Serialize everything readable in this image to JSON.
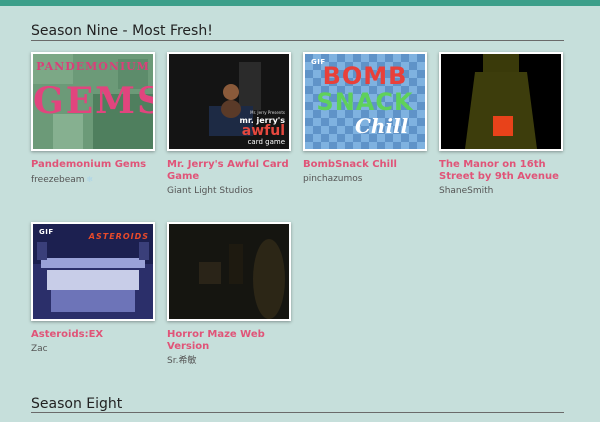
{
  "sections": [
    {
      "title": "Season Nine - Most Fresh!",
      "games": [
        {
          "title": "Pandemonium Gems",
          "author": "freezebeam",
          "author_icon": "snowflake-icon",
          "thumb_text_top": "PANDEMONIUM",
          "thumb_text_main": "GEMS"
        },
        {
          "title": "Mr. Jerry's Awful Card Game",
          "author": "Giant Light Studios",
          "thumb_text_small": "Mr. Jerry Presents",
          "thumb_text_line1": "mr. jerry's",
          "thumb_text_line2": "awful",
          "thumb_text_line3": "card game"
        },
        {
          "title": "BombSnack Chill",
          "author": "pinchazumos",
          "gif": "GIF",
          "thumb_text_bomb": "BOMB",
          "thumb_text_snack": "SNACK",
          "thumb_text_chill": "Chill"
        },
        {
          "title": "The Manor on 16th Street by 9th Avenue",
          "author": "ShaneSmith"
        }
      ]
    },
    {
      "games": [
        {
          "title": "Asteroids:EX",
          "author": "Zac",
          "gif": "GIF",
          "thumb_text": "ASTEROIDS"
        },
        {
          "title": "Horror Maze Web Version",
          "author": "Sr.希敏"
        }
      ]
    },
    {
      "title": "Season Eight"
    }
  ],
  "colors": {
    "background": "#c6dfdb",
    "accent_bar": "#3c9f8a",
    "title_pink": "#e05478"
  }
}
